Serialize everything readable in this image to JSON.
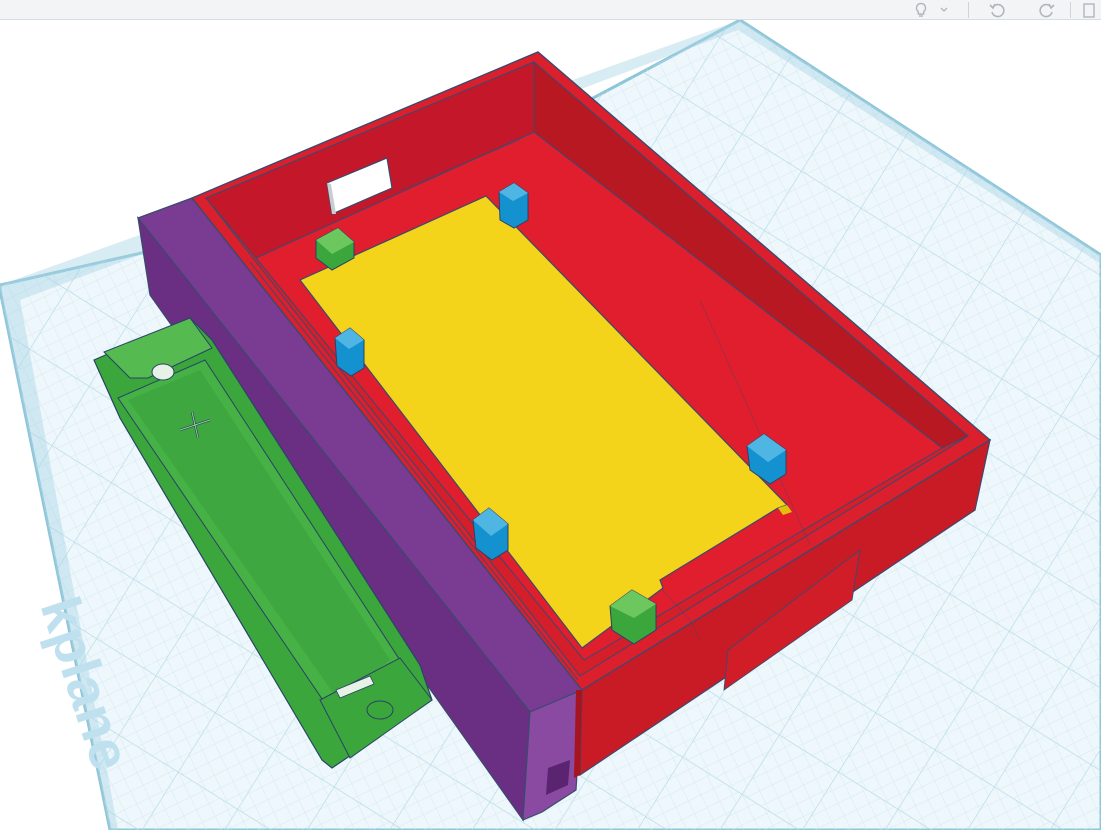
{
  "app": {
    "toolbar": {
      "buttons": [
        {
          "name": "lightbulb-icon",
          "label": ""
        },
        {
          "name": "dropdown-arrow-icon",
          "label": ""
        },
        {
          "name": "undo-icon",
          "label": ""
        },
        {
          "name": "redo-icon",
          "label": ""
        },
        {
          "name": "notes-icon",
          "label": ""
        }
      ]
    },
    "workplane": {
      "label": "Workplane",
      "label_visible_fragment": "kplane"
    }
  },
  "colors": {
    "grid_bg": "#e8f4fa",
    "grid_minor": "#c8e3ef",
    "grid_major": "#a3d0e2",
    "grid_border": "#8ec5d9",
    "box_red": "#dc1f2c",
    "box_red_dark": "#b81821",
    "box_red_inner_floor": "#e01e2e",
    "purple_wall": "#7a3b93",
    "pcb_yellow": "#f4d41b",
    "standoff_blue": "#1492cf",
    "standoff_green": "#3aa63c",
    "battery_green": "#46b245",
    "edge_line": "#3a4a6e"
  }
}
